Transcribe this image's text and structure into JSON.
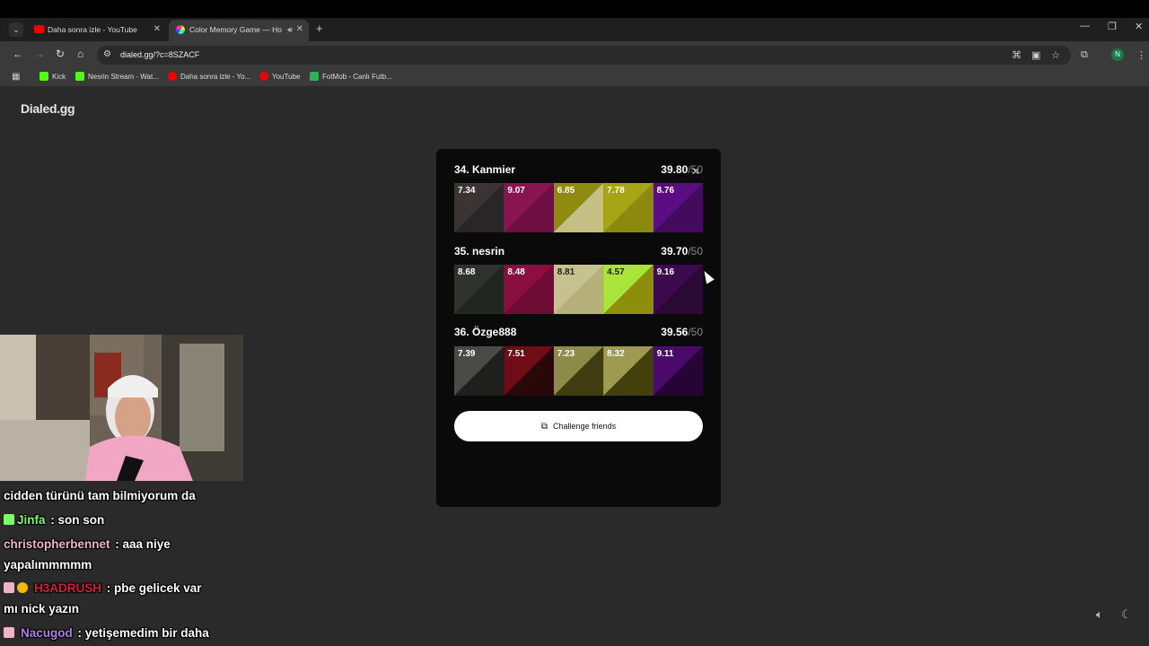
{
  "browser": {
    "tabs": [
      {
        "title": "Daha sonra izle - YouTube",
        "active": false
      },
      {
        "title": "Color Memory Game — Ho",
        "active": true
      }
    ],
    "new_tab": "+",
    "url": "dialed.gg/?c=8SZACF",
    "bookmarks": [
      "Kick",
      "Nesrin Stream - Wat...",
      "Daha sonra izle - Yo...",
      "YouTube",
      "FotMob - Canlı Futb..."
    ],
    "profile_initial": "N"
  },
  "page": {
    "brand": "Dialed.gg",
    "results": [
      {
        "rank": "34. Kanmier",
        "score": "39.80",
        "total": "/50",
        "swatches": [
          {
            "value": "7.34",
            "target": "#3b3435",
            "guess": "#2a2627"
          },
          {
            "value": "9.07",
            "target": "#8a1450",
            "guess": "#6d0f40"
          },
          {
            "value": "6.85",
            "target": "#8e8a12",
            "guess": "#c4bf84"
          },
          {
            "value": "7.78",
            "target": "#a7a416",
            "guess": "#8b8a0e"
          },
          {
            "value": "8.76",
            "target": "#5a0c80",
            "guess": "#430a5e"
          }
        ]
      },
      {
        "rank": "35. nesrin",
        "score": "39.70",
        "total": "/50",
        "swatches": [
          {
            "value": "8.68",
            "target": "#2f3330",
            "guess": "#222622"
          },
          {
            "value": "8.48",
            "target": "#8a0f3f",
            "guess": "#6e0c33"
          },
          {
            "value": "8.81",
            "target": "#c6c18e",
            "guess": "#b6b07c"
          },
          {
            "value": "4.57",
            "target": "#a8e43a",
            "guess": "#8d8f0c"
          },
          {
            "value": "9.16",
            "target": "#3e0a4e",
            "guess": "#2c0a36"
          }
        ]
      },
      {
        "rank": "36. Özge888",
        "score": "39.56",
        "total": "/50",
        "swatches": [
          {
            "value": "7.39",
            "target": "#4a4a48",
            "guess": "#1f1f1d"
          },
          {
            "value": "7.51",
            "target": "#6e0c18",
            "guess": "#2a0809"
          },
          {
            "value": "7.23",
            "target": "#8e8a4a",
            "guess": "#3e3c10"
          },
          {
            "value": "8.32",
            "target": "#9f9a52",
            "guess": "#44400c"
          },
          {
            "value": "9.11",
            "target": "#4a0a6a",
            "guess": "#260536"
          }
        ]
      }
    ],
    "challenge_label": "Challenge friends"
  },
  "chat": [
    {
      "user": "",
      "text": "cidden türünü tam bilmiyorum da",
      "color": "#ffffff"
    },
    {
      "user": "Jinfa",
      "text": " : son son",
      "color": "#7CFC6C"
    },
    {
      "user": "christopherbennet",
      "text": " : aaa niye",
      "color": "#f2b3c8"
    },
    {
      "user": "",
      "text": "yapalımmmmm",
      "color": "#ffffff"
    },
    {
      "user": "H3ADRUSH",
      "text": " : pbe gelicek var",
      "color": "#d0203a"
    },
    {
      "user": "",
      "text": "mı nick yazın",
      "color": "#ffffff"
    },
    {
      "user": "Nacugod",
      "text": " : yetişemedim bir daha",
      "color": "#b07ee8"
    }
  ],
  "icons": {
    "speaker": "speaker-icon",
    "moon": "moon-icon"
  }
}
